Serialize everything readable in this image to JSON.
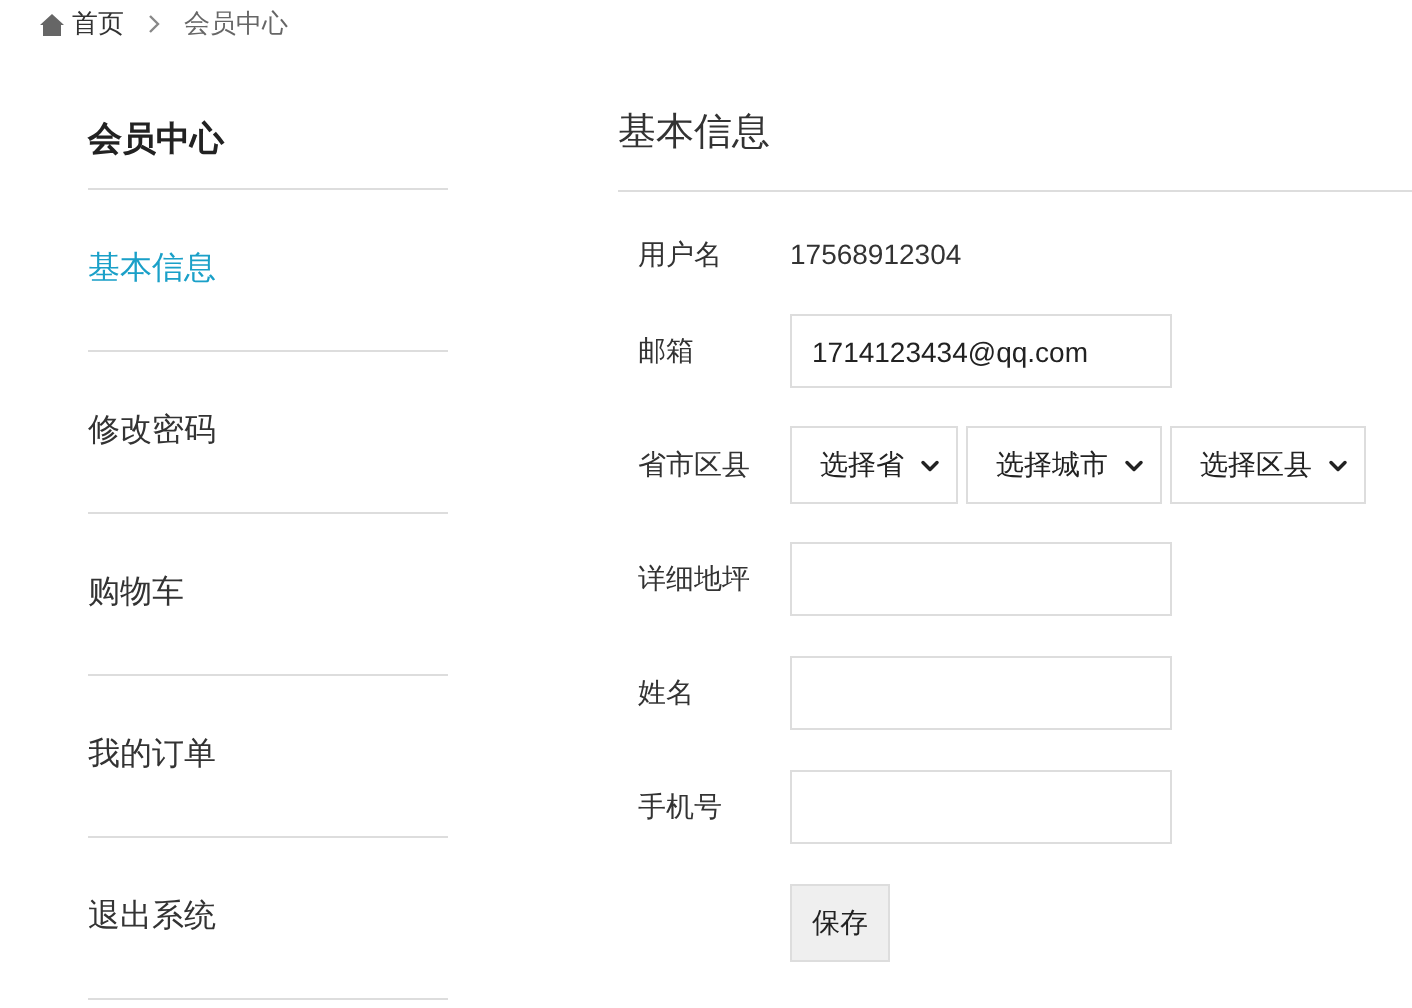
{
  "breadcrumb": [
    {
      "label": "首页"
    },
    {
      "label": "会员中心"
    }
  ],
  "sidebar": {
    "title": "会员中心",
    "items": [
      {
        "label": "基本信息",
        "selected": true
      },
      {
        "label": "修改密码",
        "selected": false
      },
      {
        "label": "购物车",
        "selected": false
      },
      {
        "label": "我的订单",
        "selected": false
      },
      {
        "label": "退出系统",
        "selected": false
      }
    ]
  },
  "content": {
    "title": "基本信息",
    "rows": [
      {
        "kind": "text",
        "label": "用户名",
        "value": "17568912304"
      },
      {
        "kind": "input",
        "label": "邮箱",
        "value": "1714123434@qq.com"
      },
      {
        "kind": "selects",
        "label": "省市区县",
        "options": [
          "选择省",
          "选择城市",
          "选择区县"
        ]
      },
      {
        "kind": "input",
        "label": "详细地坪"
      },
      {
        "kind": "input",
        "label": "姓名"
      },
      {
        "kind": "input",
        "label": "手机号"
      },
      {
        "kind": "button",
        "label": "保存"
      }
    ]
  }
}
